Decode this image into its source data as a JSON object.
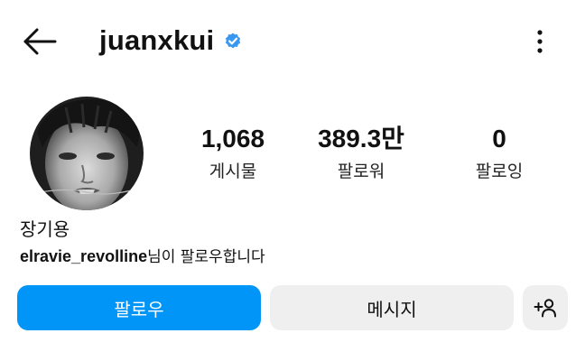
{
  "header": {
    "back_icon": "arrow-left-icon",
    "username": "juanxkui",
    "verified_icon": "verified-badge-icon",
    "more_icon": "more-vertical-icon"
  },
  "profile": {
    "avatar": "profile-photo",
    "display_name": "장기용",
    "followed_by_user": "elravie_revolline",
    "followed_by_suffix": "님이 팔로우합니다"
  },
  "stats": [
    {
      "value": "1,068",
      "label": "게시물"
    },
    {
      "value": "389.3만",
      "label": "팔로워"
    },
    {
      "value": "0",
      "label": "팔로잉"
    }
  ],
  "actions": {
    "follow_label": "팔로우",
    "message_label": "메시지",
    "add_user_icon": "add-user-icon"
  },
  "colors": {
    "accent": "#0095f6",
    "verified": "#3897f0",
    "secondary_button": "#efefef",
    "text": "#111111"
  }
}
